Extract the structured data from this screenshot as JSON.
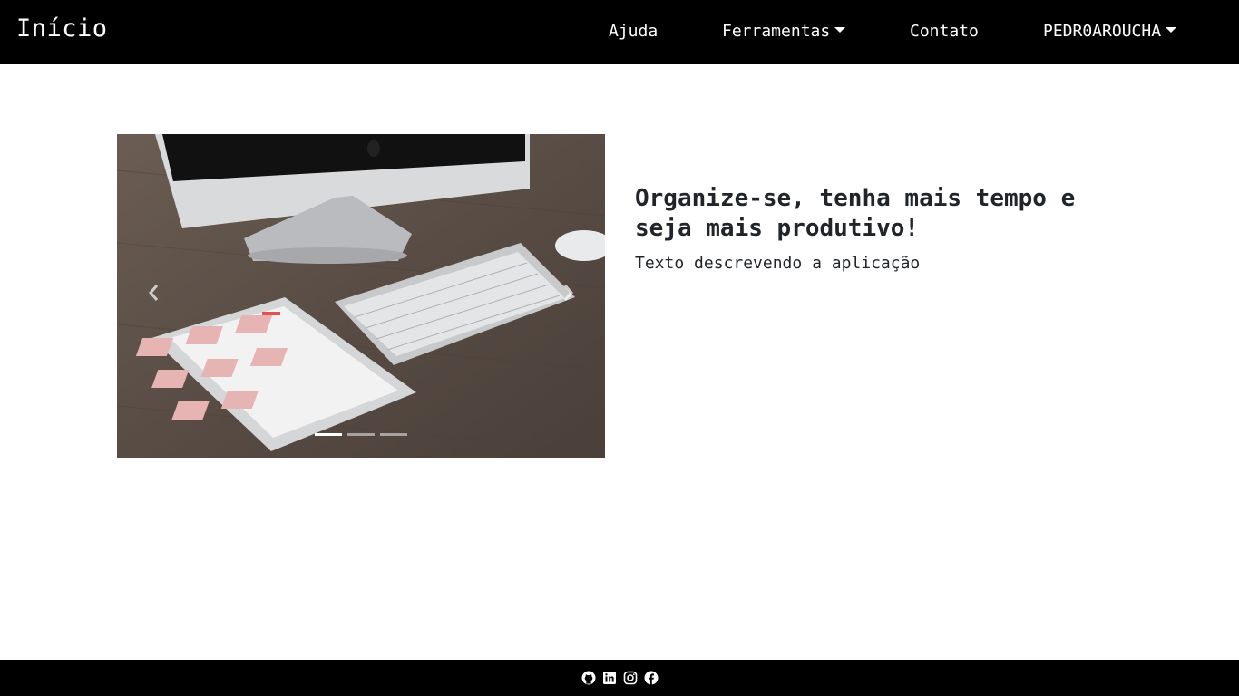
{
  "navbar": {
    "brand": "Início",
    "items": {
      "ajuda": "Ajuda",
      "ferramentas": "Ferramentas",
      "contato": "Contato",
      "user": "PEDR0AROUCHA"
    }
  },
  "carousel": {
    "slide_count": 3,
    "active_slide": 1,
    "prev_icon": "chevron-left-icon",
    "next_icon": "chevron-right-icon"
  },
  "hero": {
    "title": "Organize-se, tenha mais tempo e seja mais produtivo!",
    "subtitle": "Texto descrevendo a aplicação"
  },
  "footer": {
    "icons": [
      "github-icon",
      "linkedin-icon",
      "instagram-icon",
      "facebook-icon"
    ]
  },
  "colors": {
    "navbar_bg": "#000000",
    "footer_bg": "#000000",
    "text": "#212529"
  }
}
